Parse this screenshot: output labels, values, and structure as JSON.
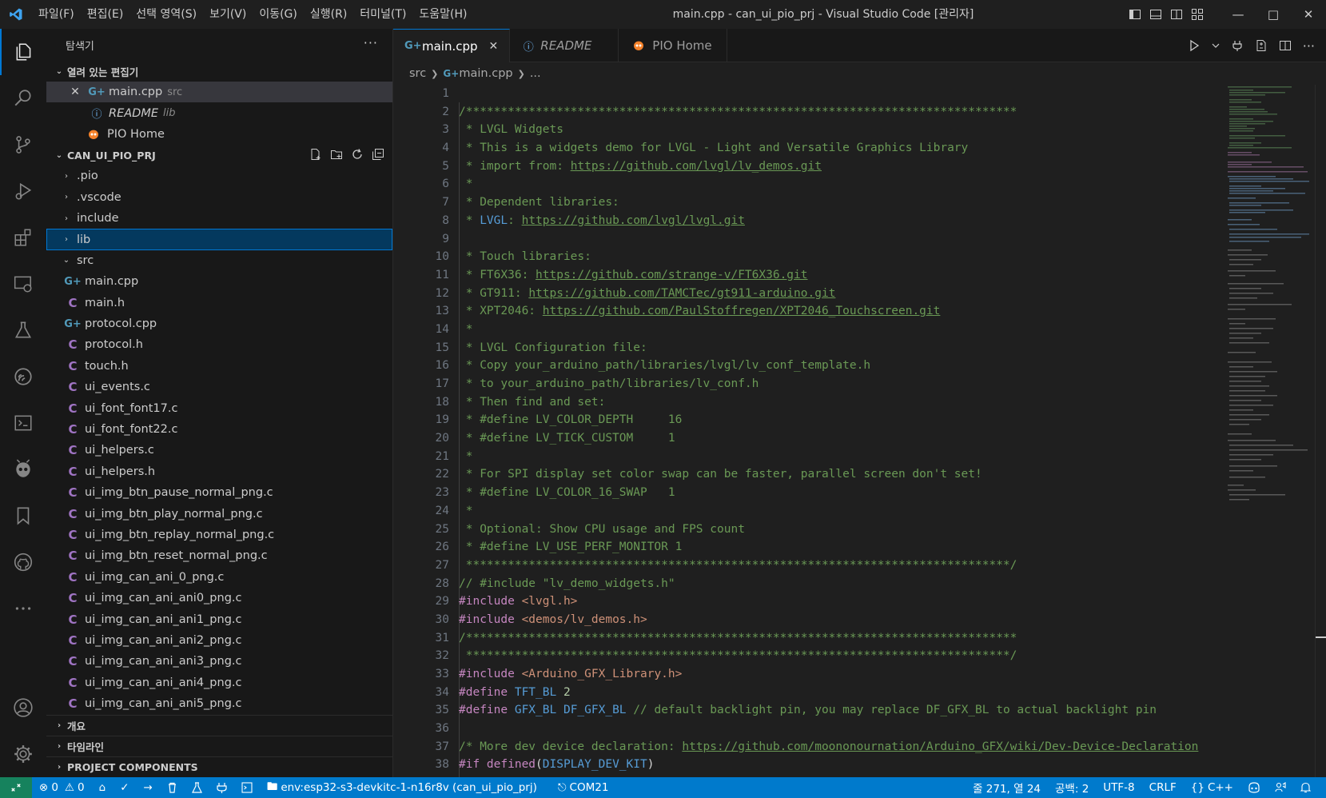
{
  "titlebar": {
    "menu": [
      "파일(F)",
      "편집(E)",
      "선택 영역(S)",
      "보기(V)",
      "이동(G)",
      "실행(R)",
      "터미널(T)",
      "도움말(H)"
    ],
    "title": "main.cpp - can_ui_pio_prj - Visual Studio Code [관리자]"
  },
  "sidebar": {
    "title": "탐색기",
    "open_editors": {
      "label": "열려 있는 편집기",
      "items": [
        {
          "name": "main.cpp",
          "desc": "src"
        },
        {
          "name": "README",
          "desc": "lib"
        },
        {
          "name": "PIO Home",
          "desc": ""
        }
      ]
    },
    "project": {
      "label": "CAN_UI_PIO_PRJ",
      "folders": [
        ".pio",
        ".vscode",
        "include",
        "lib"
      ],
      "src_label": "src",
      "files": [
        {
          "name": "main.cpp",
          "type": "cpp"
        },
        {
          "name": "main.h",
          "type": "c"
        },
        {
          "name": "protocol.cpp",
          "type": "cpp"
        },
        {
          "name": "protocol.h",
          "type": "c"
        },
        {
          "name": "touch.h",
          "type": "c"
        },
        {
          "name": "ui_events.c",
          "type": "c"
        },
        {
          "name": "ui_font_font17.c",
          "type": "c"
        },
        {
          "name": "ui_font_font22.c",
          "type": "c"
        },
        {
          "name": "ui_helpers.c",
          "type": "c"
        },
        {
          "name": "ui_helpers.h",
          "type": "c"
        },
        {
          "name": "ui_img_btn_pause_normal_png.c",
          "type": "c"
        },
        {
          "name": "ui_img_btn_play_normal_png.c",
          "type": "c"
        },
        {
          "name": "ui_img_btn_replay_normal_png.c",
          "type": "c"
        },
        {
          "name": "ui_img_btn_reset_normal_png.c",
          "type": "c"
        },
        {
          "name": "ui_img_can_ani_0_png.c",
          "type": "c"
        },
        {
          "name": "ui_img_can_ani_ani0_png.c",
          "type": "c"
        },
        {
          "name": "ui_img_can_ani_ani1_png.c",
          "type": "c"
        },
        {
          "name": "ui_img_can_ani_ani2_png.c",
          "type": "c"
        },
        {
          "name": "ui_img_can_ani_ani3_png.c",
          "type": "c"
        },
        {
          "name": "ui_img_can_ani_ani4_png.c",
          "type": "c"
        },
        {
          "name": "ui_img_can_ani_ani5_png.c",
          "type": "c"
        }
      ]
    },
    "outline_label": "개요",
    "timeline_label": "타임라인",
    "components_label": "PROJECT COMPONENTS"
  },
  "tabs": [
    {
      "label": "main.cpp",
      "active": true
    },
    {
      "label": "README",
      "active": false
    },
    {
      "label": "PIO Home",
      "active": false
    }
  ],
  "breadcrumb": [
    "src",
    "main.cpp",
    "..."
  ],
  "editor": {
    "lines": [
      [],
      [
        [
          "c",
          "/*******************************************************************************"
        ]
      ],
      [
        [
          "c",
          " * LVGL Widgets"
        ]
      ],
      [
        [
          "c",
          " * This is a widgets demo for LVGL - Light and Versatile Graphics Library"
        ]
      ],
      [
        [
          "c",
          " * import from: "
        ],
        [
          "cu",
          "https://github.com/lvgl/lv_demos.git"
        ]
      ],
      [
        [
          "c",
          " *"
        ]
      ],
      [
        [
          "c",
          " * Dependent libraries:"
        ]
      ],
      [
        [
          "c",
          " * "
        ],
        [
          "m",
          "LVGL"
        ],
        [
          "c",
          ": "
        ],
        [
          "cu",
          "https://github.com/lvgl/lvgl.git"
        ]
      ],
      [],
      [
        [
          "c",
          " * Touch libraries:"
        ]
      ],
      [
        [
          "c",
          " * FT6X36: "
        ],
        [
          "cu",
          "https://github.com/strange-v/FT6X36.git"
        ]
      ],
      [
        [
          "c",
          " * GT911: "
        ],
        [
          "cu",
          "https://github.com/TAMCTec/gt911-arduino.git"
        ]
      ],
      [
        [
          "c",
          " * XPT2046: "
        ],
        [
          "cu",
          "https://github.com/PaulStoffregen/XPT2046_Touchscreen.git"
        ]
      ],
      [
        [
          "c",
          " *"
        ]
      ],
      [
        [
          "c",
          " * LVGL Configuration file:"
        ]
      ],
      [
        [
          "c",
          " * Copy your_arduino_path/libraries/lvgl/lv_conf_template.h"
        ]
      ],
      [
        [
          "c",
          " * to your_arduino_path/libraries/lv_conf.h"
        ]
      ],
      [
        [
          "c",
          " * Then find and set:"
        ]
      ],
      [
        [
          "c",
          " * #define LV_COLOR_DEPTH     16"
        ]
      ],
      [
        [
          "c",
          " * #define LV_TICK_CUSTOM     1"
        ]
      ],
      [
        [
          "c",
          " *"
        ]
      ],
      [
        [
          "c",
          " * For SPI display set color swap can be faster, parallel screen don't set!"
        ]
      ],
      [
        [
          "c",
          " * #define LV_COLOR_16_SWAP   1"
        ]
      ],
      [
        [
          "c",
          " *"
        ]
      ],
      [
        [
          "c",
          " * Optional: Show CPU usage and FPS count"
        ]
      ],
      [
        [
          "c",
          " * #define LV_USE_PERF_MONITOR 1"
        ]
      ],
      [
        [
          "c",
          " ******************************************************************************/"
        ]
      ],
      [
        [
          "c",
          "// #include \"lv_demo_widgets.h\""
        ]
      ],
      [
        [
          "k",
          "#include "
        ],
        [
          "s",
          "<lvgl.h>"
        ]
      ],
      [
        [
          "k",
          "#include "
        ],
        [
          "s",
          "<demos/lv_demos.h>"
        ]
      ],
      [
        [
          "c",
          "/*******************************************************************************"
        ]
      ],
      [
        [
          "c",
          " ******************************************************************************/"
        ]
      ],
      [
        [
          "k",
          "#include "
        ],
        [
          "s",
          "<Arduino_GFX_Library.h>"
        ]
      ],
      [
        [
          "k",
          "#define "
        ],
        [
          "m",
          "TFT_BL"
        ],
        [
          "p",
          " "
        ],
        [
          "n",
          "2"
        ]
      ],
      [
        [
          "k",
          "#define "
        ],
        [
          "m",
          "GFX_BL"
        ],
        [
          "p",
          " "
        ],
        [
          "m",
          "DF_GFX_BL"
        ],
        [
          "c",
          " // default backlight pin, you may replace DF_GFX_BL to actual backlight pin"
        ]
      ],
      [],
      [
        [
          "c",
          "/* More dev device declaration: "
        ],
        [
          "cu",
          "https://github.com/moononournation/Arduino_GFX/wiki/Dev-Device-Declaration"
        ]
      ],
      [
        [
          "k",
          "#if "
        ],
        [
          "k",
          "defined"
        ],
        [
          "p",
          "("
        ],
        [
          "m",
          "DISPLAY_DEV_KIT"
        ],
        [
          "p",
          ")"
        ]
      ]
    ]
  },
  "statusbar": {
    "errors": "0",
    "warnings": "0",
    "env": "env:esp32-s3-devkitc-1-n16r8v (can_ui_pio_prj)",
    "port": "COM21",
    "position": "줄 271, 열 24",
    "spaces": "공백: 2",
    "encoding": "UTF-8",
    "eol": "CRLF",
    "language": "C++"
  },
  "colors": {
    "accent": "#0078d4",
    "statusbar": "#007acc",
    "selected_row": "#04395e"
  }
}
